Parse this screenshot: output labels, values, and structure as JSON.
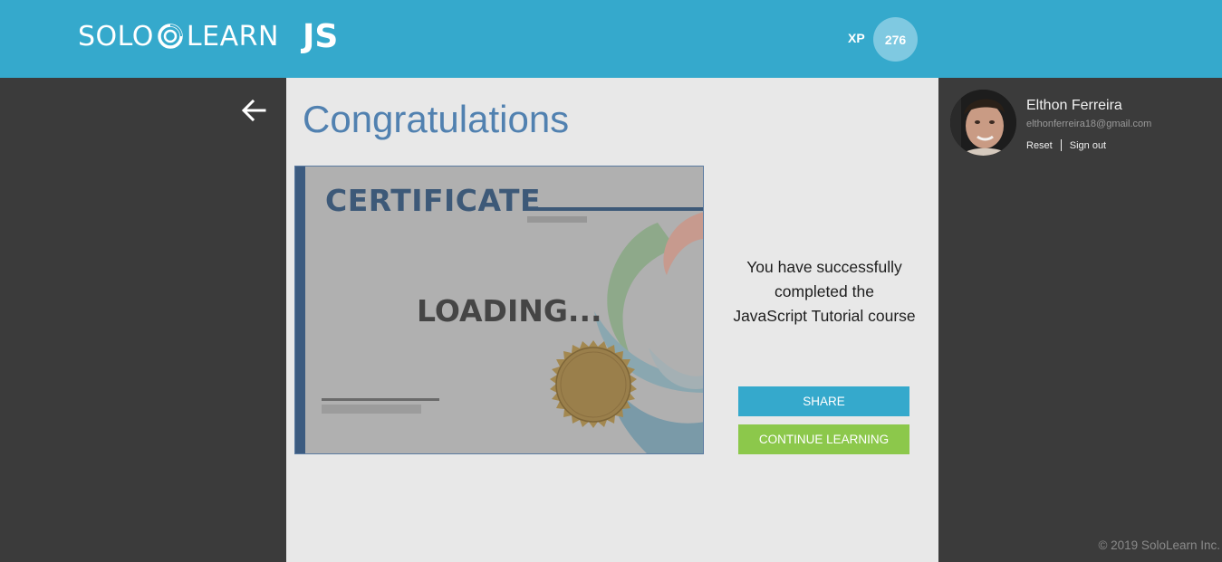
{
  "header": {
    "logo_left": "SOLO",
    "logo_right": "LEARN",
    "course": "JS",
    "xp_label": "XP",
    "xp_value": "276"
  },
  "main": {
    "heading": "Congratulations",
    "certificate": {
      "title": "CERTIFICATE",
      "status": "LOADING..."
    },
    "message": {
      "line1": "You have successfully",
      "line2": "completed the",
      "line3": "JavaScript Tutorial course"
    },
    "buttons": {
      "share": "SHARE",
      "continue": "CONTINUE LEARNING"
    }
  },
  "user": {
    "name": "Elthon Ferreira",
    "email": "elthonferreira18@gmail.com",
    "reset": "Reset",
    "sign_out": "Sign out"
  },
  "footer": {
    "copyright": "© 2019 SoloLearn Inc."
  },
  "colors": {
    "brand_blue": "#35a9cc",
    "continue_green": "#8cc84b",
    "heading_blue": "#5181b0"
  },
  "icons": {
    "back": "arrow-left-icon",
    "logo": "sololearn-swirl-icon"
  }
}
